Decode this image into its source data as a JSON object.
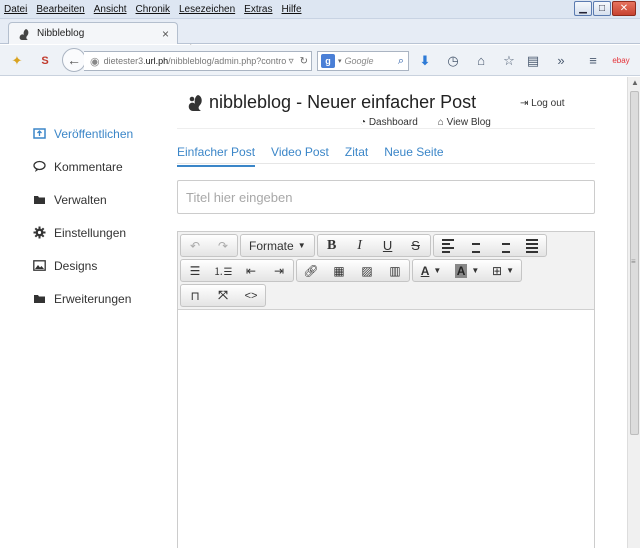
{
  "browser": {
    "menu": [
      "Datei",
      "Bearbeiten",
      "Ansicht",
      "Chronik",
      "Lesezeichen",
      "Extras",
      "Hilfe"
    ],
    "tab_title": "Nibbleblog",
    "url_prefix": "dietester3.",
    "url_domain": "url.ph",
    "url_rest": "/nibbleblog/admin.php?contro",
    "search_engine": "Google",
    "new_tab": "+",
    "tab_close": "×"
  },
  "header": {
    "title": "nibbleblog - Neuer einfacher Post",
    "logout": "Log out",
    "dashboard": "Dashboard",
    "view_blog": "View Blog"
  },
  "sidebar": {
    "items": [
      {
        "label": "Veröffentlichen",
        "icon": "publish-icon",
        "active": true
      },
      {
        "label": "Kommentare",
        "icon": "comment-icon",
        "active": false
      },
      {
        "label": "Verwalten",
        "icon": "folder-icon",
        "active": false
      },
      {
        "label": "Einstellungen",
        "icon": "gear-icon",
        "active": false
      },
      {
        "label": "Designs",
        "icon": "image-icon",
        "active": false
      },
      {
        "label": "Erweiterungen",
        "icon": "folder-icon",
        "active": false
      }
    ]
  },
  "post_tabs": [
    "Einfacher Post",
    "Video Post",
    "Zitat",
    "Neue Seite"
  ],
  "title_input": {
    "placeholder": "Titel hier eingeben",
    "value": ""
  },
  "editor": {
    "formats_label": "Formate"
  },
  "colors": {
    "accent": "#3b86c8",
    "menubar": "#dde6f2",
    "toolbar": "#f2f2f2"
  }
}
